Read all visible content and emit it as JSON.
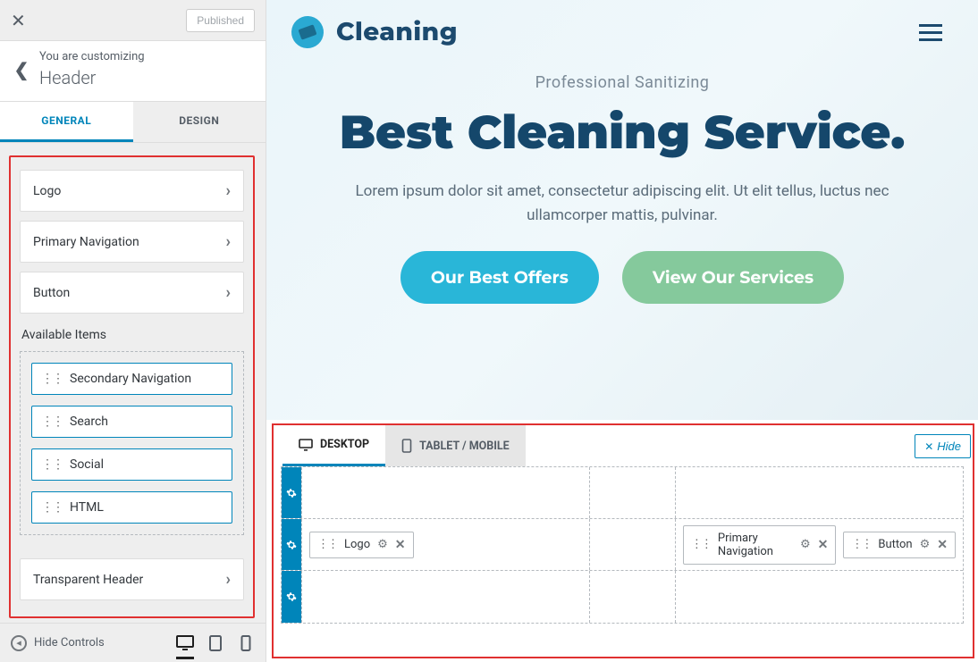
{
  "sidebar": {
    "published_label": "Published",
    "crumb_small": "You are customizing",
    "crumb_big": "Header",
    "tabs": {
      "general": "GENERAL",
      "design": "DESIGN"
    },
    "config_items": [
      "Logo",
      "Primary Navigation",
      "Button"
    ],
    "available_label": "Available Items",
    "available_items": [
      "Secondary Navigation",
      "Search",
      "Social",
      "HTML"
    ],
    "transparent_label": "Transparent Header",
    "footer": {
      "hide_controls": "Hide Controls"
    }
  },
  "preview": {
    "logo_text": "Cleaning",
    "subhead": "Professional Sanitizing",
    "headline": "Best Cleaning Service.",
    "lead": "Lorem ipsum dolor sit amet, consectetur adipiscing elit. Ut elit tellus, luctus nec ullamcorper mattis, pulvinar.",
    "cta_primary": "Our Best Offers",
    "cta_secondary": "View Our Services"
  },
  "builder": {
    "tab_desktop": "DESKTOP",
    "tab_mobile": "TABLET / MOBILE",
    "hide_label": "Hide",
    "chips": {
      "logo": "Logo",
      "primary_nav": "Primary Navigation",
      "button": "Button"
    }
  }
}
